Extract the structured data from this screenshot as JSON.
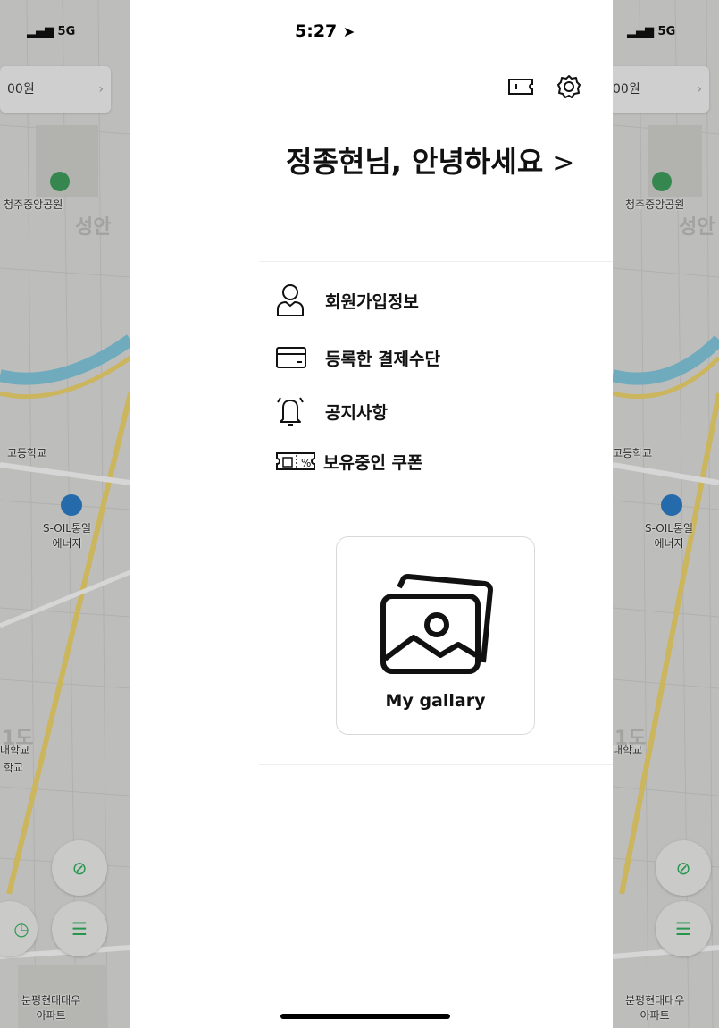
{
  "status": {
    "time": "5:27",
    "network": "5G"
  },
  "header": {
    "ticket_icon": "ticket-icon",
    "settings_icon": "gear-icon"
  },
  "greeting": {
    "text": "정종현님, 안녕하세요",
    "chevron": ">"
  },
  "menu": [
    {
      "label": "회원가입정보",
      "icon": "user-icon"
    },
    {
      "label": "등록한 결제수단",
      "icon": "credit-card-icon"
    },
    {
      "label": "공지사항",
      "icon": "bell-icon"
    },
    {
      "label": "보유중인 쿠폰",
      "icon": "coupon-icon"
    }
  ],
  "gallery": {
    "label": "My gallary",
    "icon": "images-icon"
  },
  "map": {
    "fare_fragment": "00원",
    "park": "청주중앙공원",
    "district": "성안",
    "school": "고등학교",
    "gas_station": "S-OIL통일\n에너지",
    "school2": "대학교",
    "school3": "학교",
    "apartment": "분평현대대우\n아파트",
    "zone": "1도"
  },
  "colors": {
    "accent": "#000000",
    "map_bg": "#d9d9d7",
    "road_yellow": "#e8cf6a",
    "river": "#7fc3d8"
  }
}
